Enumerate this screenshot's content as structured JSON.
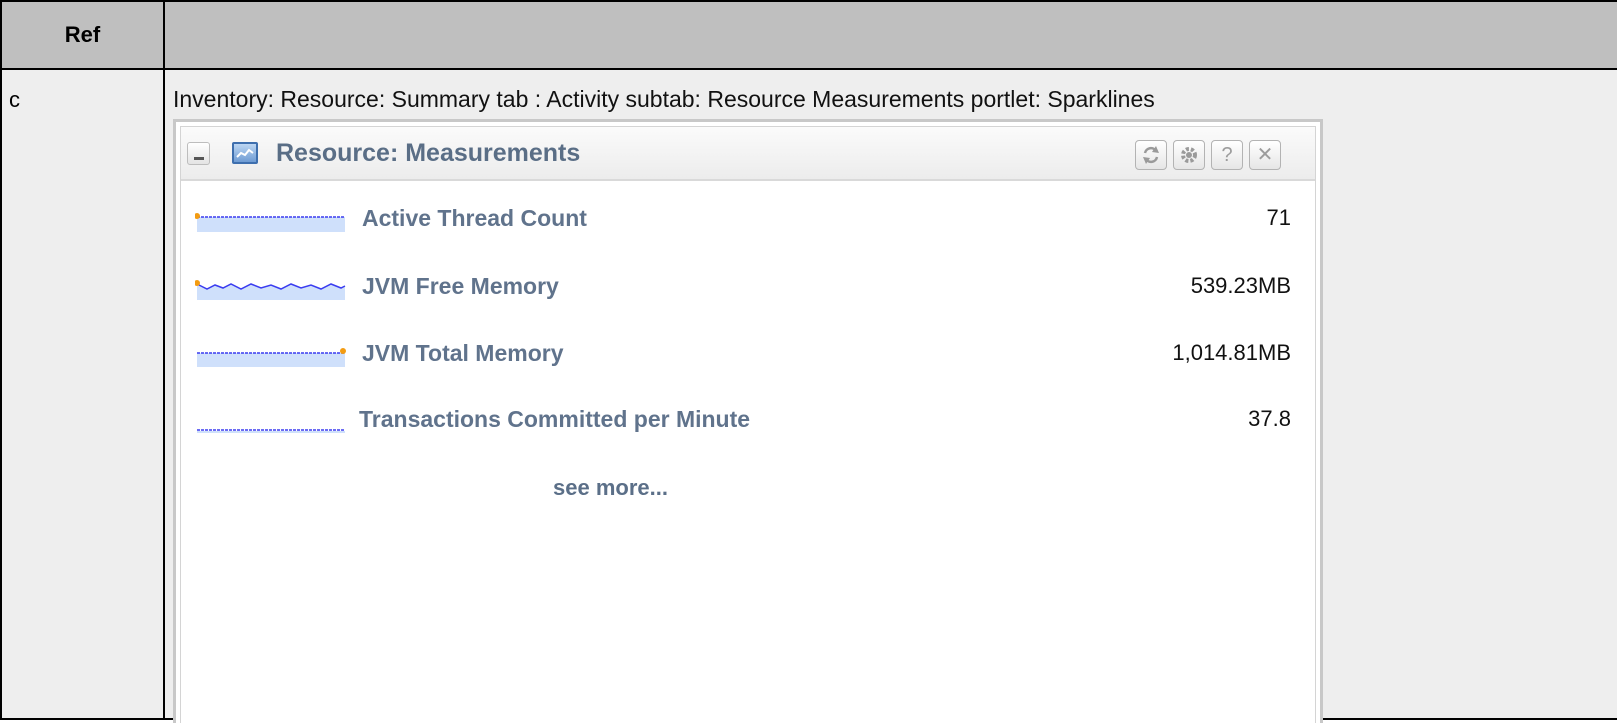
{
  "table": {
    "ref_header": "Ref",
    "main_header": "",
    "ref_value": "c",
    "caption": "Inventory: Resource: Summary tab : Activity subtab: Resource Measurements portlet: Sparklines"
  },
  "portlet": {
    "title": "Resource: Measurements",
    "icon": "measurements-chart-icon",
    "header_buttons": [
      "refresh-icon",
      "settings-gear-icon",
      "help-icon",
      "close-icon"
    ],
    "help_label": "?",
    "close_label": "✕",
    "metrics": [
      {
        "name": "Active Thread Count",
        "value": "71",
        "sparkline": "flat",
        "marker": "start"
      },
      {
        "name": "JVM Free Memory",
        "value": "539.23MB",
        "sparkline": "wavy",
        "marker": "start"
      },
      {
        "name": "JVM Total Memory",
        "value": "1,014.81MB",
        "sparkline": "flat",
        "marker": "end"
      },
      {
        "name": "Transactions Committed per Minute",
        "value": "37.8",
        "sparkline": "flat-low",
        "marker": "none"
      }
    ],
    "see_more": "see more..."
  },
  "colors": {
    "sparkline_line": "#3a3cf0",
    "sparkline_fill": "#cfe0fb",
    "sparkline_marker": "#f39c12",
    "metric_name": "#60738c",
    "table_header_bg": "#bfbfbf",
    "cell_bg": "#eeeeee"
  }
}
